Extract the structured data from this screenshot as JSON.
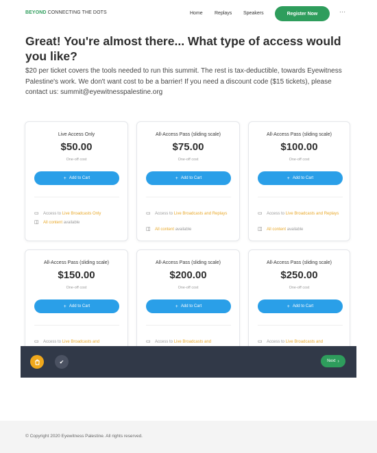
{
  "header": {
    "logo_brand": "BEYOND",
    "logo_tagline": " CONNECTING THE DOTS",
    "nav": [
      "Home",
      "Replays",
      "Speakers"
    ],
    "register_label": "Register Now",
    "more_label": "···"
  },
  "main": {
    "title": "Great! You're almost there... What type of access would you like?",
    "intro": "$20 per ticket covers the tools needed to run this summit. The rest is tax-deductible, towards Eyewitness Palestine's work. We don't want cost to be a barrier! If you need a discount code ($15 tickets), please contact us: summit@eyewitnesspalestine.org",
    "add_label": "Add to Cart",
    "cost_label": "One-off cost",
    "feature_access_prefix": "Access to ",
    "feature_content": "All content",
    "feature_available": " available",
    "cards": [
      {
        "name": "Live Access Only",
        "price": "$50.00",
        "access": "Live Broadcasts Only"
      },
      {
        "name": "All-Access Pass (sliding scale)",
        "price": "$75.00",
        "access": "Live Broadcasts and Replays"
      },
      {
        "name": "All-Access Pass (sliding scale)",
        "price": "$100.00",
        "access": "Live Broadcasts and Replays"
      },
      {
        "name": "All-Access Pass (sliding scale)",
        "price": "$150.00",
        "access": "Live Broadcasts and"
      },
      {
        "name": "All-Access Pass (sliding scale)",
        "price": "$200.00",
        "access": "Live Broadcasts and"
      },
      {
        "name": "All-Access Pass (sliding scale)",
        "price": "$250.00",
        "access": "Live Broadcasts and"
      }
    ]
  },
  "bar": {
    "next_label": "Next"
  },
  "footer": {
    "copyright": "© Copyright 2020 Eyewitness Palestine. All rights reserved."
  },
  "icons": {
    "cart": "cart-icon",
    "check": "check-icon",
    "monitor": "monitor-icon",
    "content": "content-icon",
    "plus": "plus-icon",
    "chevron": "chevron-right-icon"
  },
  "colors": {
    "green": "#2e9d5c",
    "blue": "#2a9fe8",
    "orange": "#e8a82a",
    "bar": "#313948"
  }
}
